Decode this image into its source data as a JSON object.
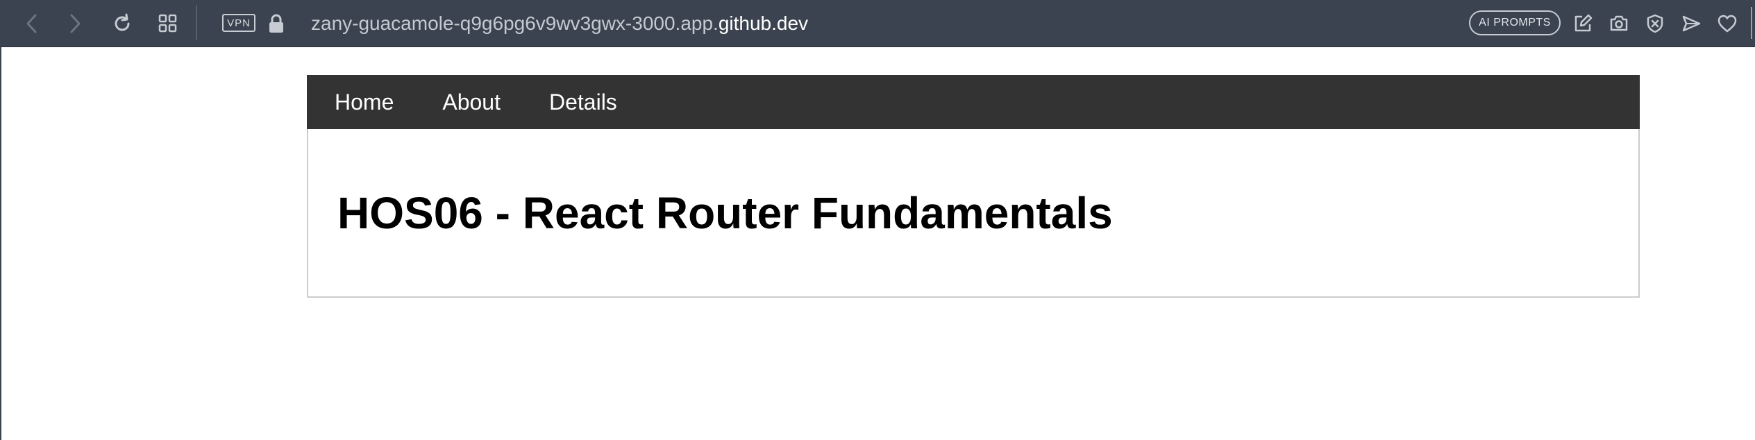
{
  "browser": {
    "url_prefix": "zany-guacamole-q9g6pg6v9wv3gwx-3000.app.",
    "url_domain": "github.dev",
    "vpn_label": "VPN",
    "ai_prompts_label": "AI PROMPTS",
    "icons": {
      "back": "chevron-left-icon",
      "forward": "chevron-right-icon",
      "reload": "reload-icon",
      "tabs": "grid-icon",
      "lock": "lock-icon",
      "edit": "edit-icon",
      "camera": "camera-icon",
      "shield": "shield-x-icon",
      "send": "send-icon",
      "heart": "heart-icon"
    },
    "colors": {
      "chrome_bg": "#3b4350",
      "icon": "#c7ccd3"
    }
  },
  "app": {
    "nav": {
      "items": [
        {
          "label": "Home"
        },
        {
          "label": "About"
        },
        {
          "label": "Details"
        }
      ],
      "background": "#333333"
    },
    "title": "HOS06 - React Router Fundamentals"
  }
}
